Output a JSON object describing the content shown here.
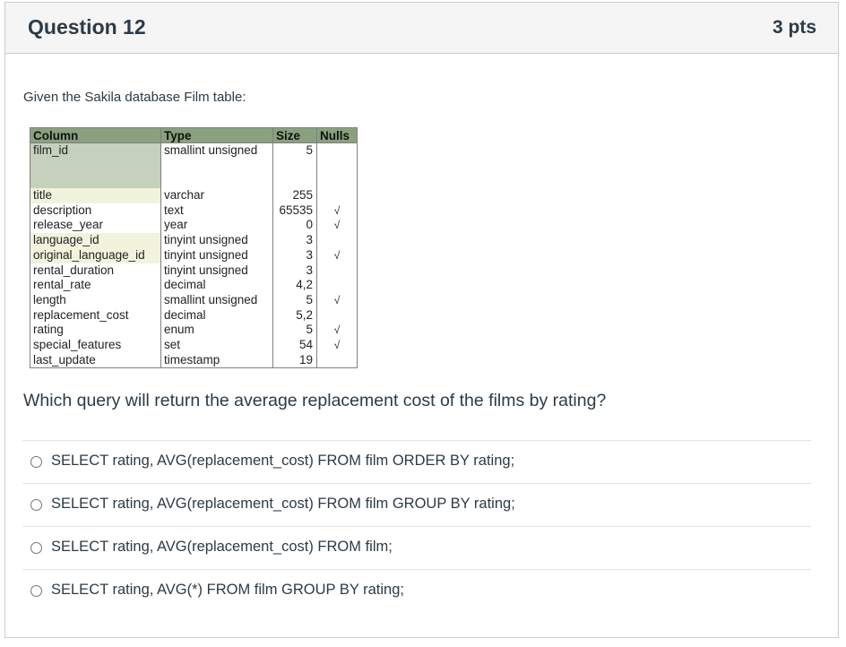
{
  "question": {
    "title": "Question 12",
    "points": "3 pts"
  },
  "intro": "Given the Sakila database Film table:",
  "table": {
    "headers": [
      "Column",
      "Type",
      "Size",
      "Nulls"
    ],
    "rows": [
      {
        "column": "film_id",
        "type": "smallint unsigned",
        "size": "5",
        "nulls": "",
        "kind": "pk"
      },
      {
        "column": "title",
        "type": "varchar",
        "size": "255",
        "nulls": "",
        "kind": "fk"
      },
      {
        "column": "description",
        "type": "text",
        "size": "65535",
        "nulls": "√",
        "kind": ""
      },
      {
        "column": "release_year",
        "type": "year",
        "size": "0",
        "nulls": "√",
        "kind": ""
      },
      {
        "column": "language_id",
        "type": "tinyint unsigned",
        "size": "3",
        "nulls": "",
        "kind": "fk"
      },
      {
        "column": "original_language_id",
        "type": "tinyint unsigned",
        "size": "3",
        "nulls": "√",
        "kind": "fk"
      },
      {
        "column": "rental_duration",
        "type": "tinyint unsigned",
        "size": "3",
        "nulls": "",
        "kind": ""
      },
      {
        "column": "rental_rate",
        "type": "decimal",
        "size": "4,2",
        "nulls": "",
        "kind": ""
      },
      {
        "column": "length",
        "type": "smallint unsigned",
        "size": "5",
        "nulls": "√",
        "kind": ""
      },
      {
        "column": "replacement_cost",
        "type": "decimal",
        "size": "5,2",
        "nulls": "",
        "kind": ""
      },
      {
        "column": "rating",
        "type": "enum",
        "size": "5",
        "nulls": "√",
        "kind": ""
      },
      {
        "column": "special_features",
        "type": "set",
        "size": "54",
        "nulls": "√",
        "kind": ""
      },
      {
        "column": "last_update",
        "type": "timestamp",
        "size": "19",
        "nulls": "",
        "kind": ""
      }
    ]
  },
  "prompt": "Which query will return the average replacement cost of the films by rating?",
  "answers": [
    "SELECT rating, AVG(replacement_cost) FROM film ORDER BY rating;",
    "SELECT rating, AVG(replacement_cost) FROM film GROUP BY rating;",
    "SELECT rating, AVG(replacement_cost) FROM film;",
    "SELECT rating, AVG(*) FROM film GROUP BY rating;"
  ],
  "colors": {
    "header_bg": "#f5f5f5",
    "table_header": "#8aa07f",
    "pk_cell": "#c3d1bd",
    "fk_cell": "#f1f3dc"
  }
}
